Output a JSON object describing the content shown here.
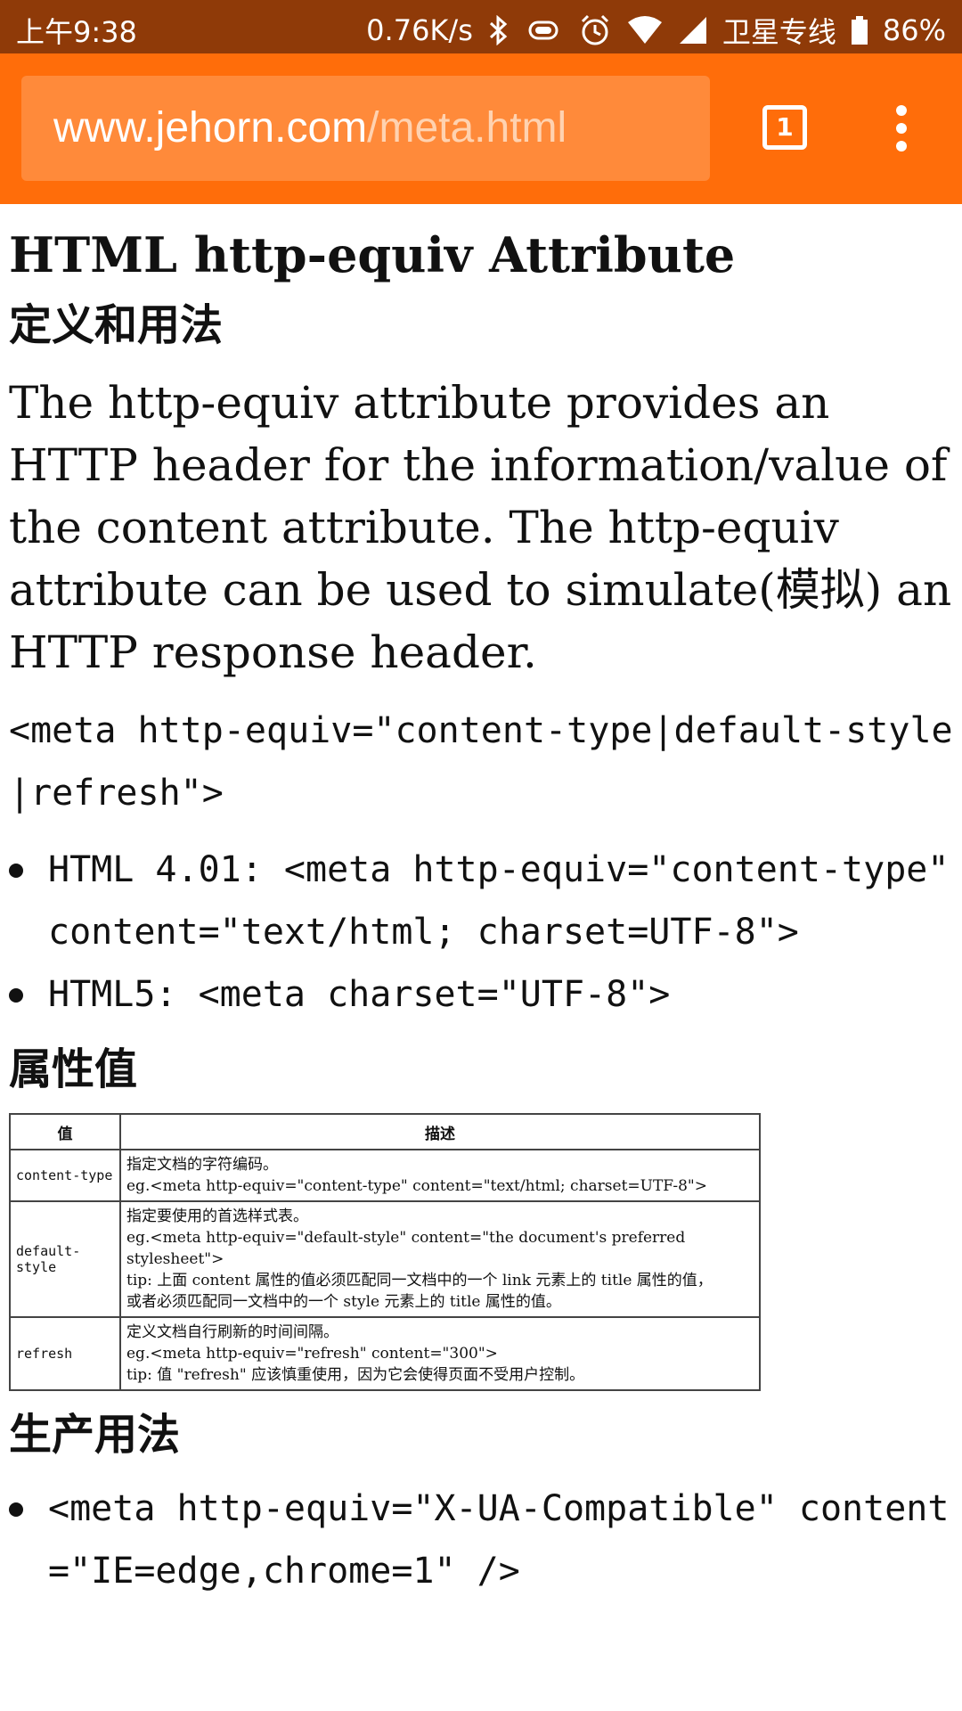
{
  "status_bar": {
    "time": "上午9:38",
    "speed": "0.76K/s",
    "carrier": "卫星专线",
    "battery": "86%"
  },
  "browser": {
    "url_host": "www.jehorn.com",
    "url_path": "/meta.html",
    "tab_count": "1"
  },
  "article": {
    "title": "HTML http-equiv Attribute",
    "section1_heading": "定义和用法",
    "intro": "The http-equiv attribute provides an HTTP header for the information/value of the content attribute. The http-equiv attribute can be used to simulate(模拟) an HTTP response header.",
    "syntax": "<meta http-equiv=\"content-type|default-style|refresh\">",
    "bullets": [
      "HTML 4.01: <meta http-equiv=\"content-type\" content=\"text/html; charset=UTF-8\">",
      "HTML5: <meta charset=\"UTF-8\">"
    ],
    "section2_heading": "属性值",
    "table": {
      "headers": [
        "值",
        "描述"
      ],
      "rows": [
        {
          "value": "content-type",
          "lines": [
            "指定文档的字符编码。",
            "eg.<meta http-equiv=\"content-type\" content=\"text/html; charset=UTF-8\">"
          ]
        },
        {
          "value": "default-style",
          "lines": [
            "指定要使用的首选样式表。",
            "eg.<meta http-equiv=\"default-style\" content=\"the document's preferred stylesheet\">",
            "tip: 上面 content 属性的值必须匹配同一文档中的一个 link 元素上的 title 属性的值，",
            "或者必须匹配同一文档中的一个 style 元素上的 title 属性的值。"
          ]
        },
        {
          "value": "refresh",
          "lines": [
            "定义文档自行刷新的时间间隔。",
            "eg.<meta http-equiv=\"refresh\" content=\"300\">",
            "tip: 值 \"refresh\" 应该慎重使用，因为它会使得页面不受用户控制。"
          ]
        }
      ]
    },
    "section3_heading": "生产用法",
    "production_bullets": [
      "<meta http-equiv=\"X-UA-Compatible\" content=\"IE=edge,chrome=1\" />"
    ]
  }
}
